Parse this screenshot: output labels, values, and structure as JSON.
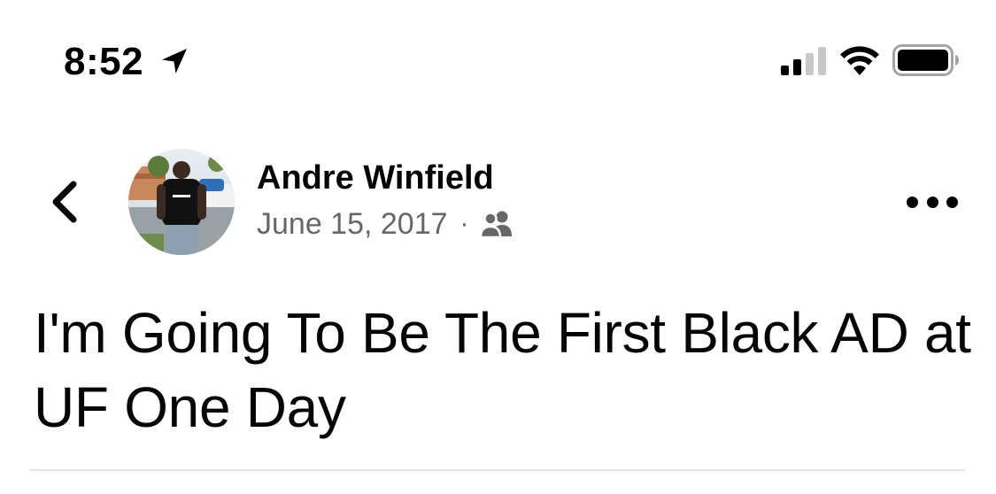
{
  "status_bar": {
    "time": "8:52",
    "location_icon": "location-arrow-icon",
    "signal_icon": "cellular-signal-icon",
    "wifi_icon": "wifi-icon",
    "battery_icon": "battery-icon"
  },
  "post": {
    "author_name": "Andre Winfield",
    "date": "June 15, 2017",
    "separator": "·",
    "audience_icon": "friends-icon",
    "text": "I'm Going To Be The First Black AD at UF One Day"
  },
  "nav": {
    "back_icon": "chevron-left-icon",
    "more_icon": "more-horizontal-icon"
  },
  "colors": {
    "text_primary": "#050505",
    "text_secondary": "#65676b",
    "divider": "#e4e6eb"
  }
}
